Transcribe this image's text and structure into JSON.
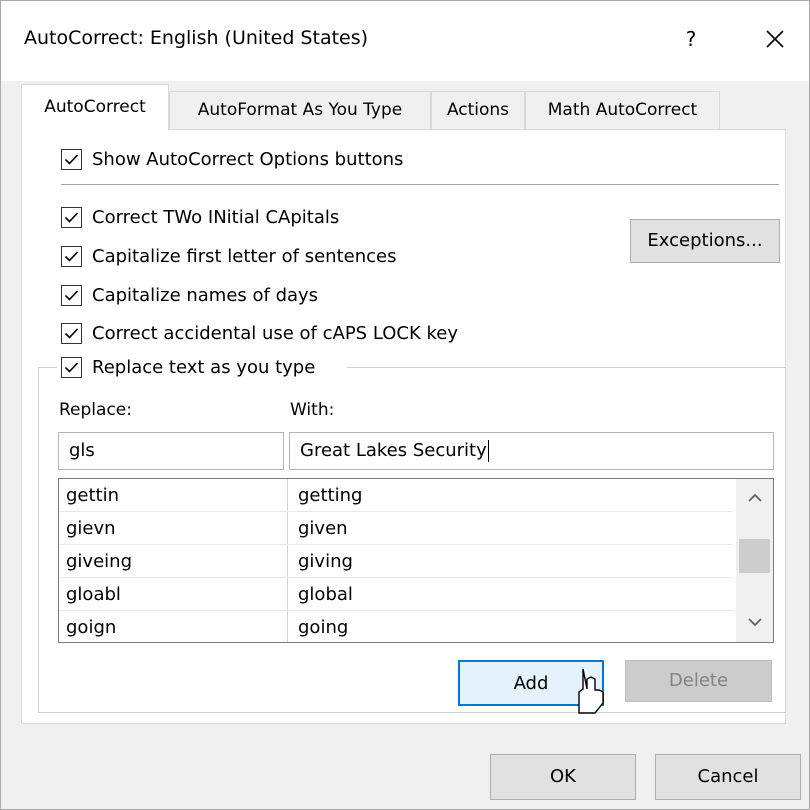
{
  "window": {
    "title": "AutoCorrect: English (United States)",
    "help": "?"
  },
  "tabs": [
    {
      "label": "AutoCorrect",
      "active": true
    },
    {
      "label": "AutoFormat As You Type",
      "active": false
    },
    {
      "label": "Actions",
      "active": false
    },
    {
      "label": "Math AutoCorrect",
      "active": false
    }
  ],
  "options": {
    "show_buttons": {
      "label": "Show AutoCorrect Options buttons",
      "checked": true
    },
    "two_initial_caps": {
      "label": "Correct TWo INitial CApitals",
      "checked": true
    },
    "capitalize_sentences": {
      "label": "Capitalize first letter of sentences",
      "checked": true
    },
    "capitalize_days": {
      "label": "Capitalize names of days",
      "checked": true
    },
    "caps_lock": {
      "label": "Correct accidental use of cAPS LOCK key",
      "checked": true
    },
    "replace_text": {
      "label": "Replace text as you type",
      "checked": true
    }
  },
  "buttons": {
    "exceptions": "Exceptions...",
    "add": "Add",
    "delete": "Delete",
    "ok": "OK",
    "cancel": "Cancel"
  },
  "replace": {
    "replace_label": "Replace:",
    "with_label": "With:",
    "replace_value": "gls",
    "with_value": "Great Lakes Security"
  },
  "entries": [
    {
      "replace": "gettin",
      "with": "getting"
    },
    {
      "replace": "gievn",
      "with": "given"
    },
    {
      "replace": "giveing",
      "with": "giving"
    },
    {
      "replace": "gloabl",
      "with": "global"
    },
    {
      "replace": "goign",
      "with": "going"
    }
  ],
  "colors": {
    "dialog_bg": "#f0f0f0",
    "button_focus_border": "#0078d7",
    "button_focus_bg": "#e5f1fb",
    "disabled_text": "#838383"
  },
  "icons": {
    "close": "close-icon",
    "check": "checkmark-icon",
    "scroll_up": "chevron-up-icon",
    "scroll_down": "chevron-down-icon",
    "cursor": "mouse-pointer-icon"
  }
}
